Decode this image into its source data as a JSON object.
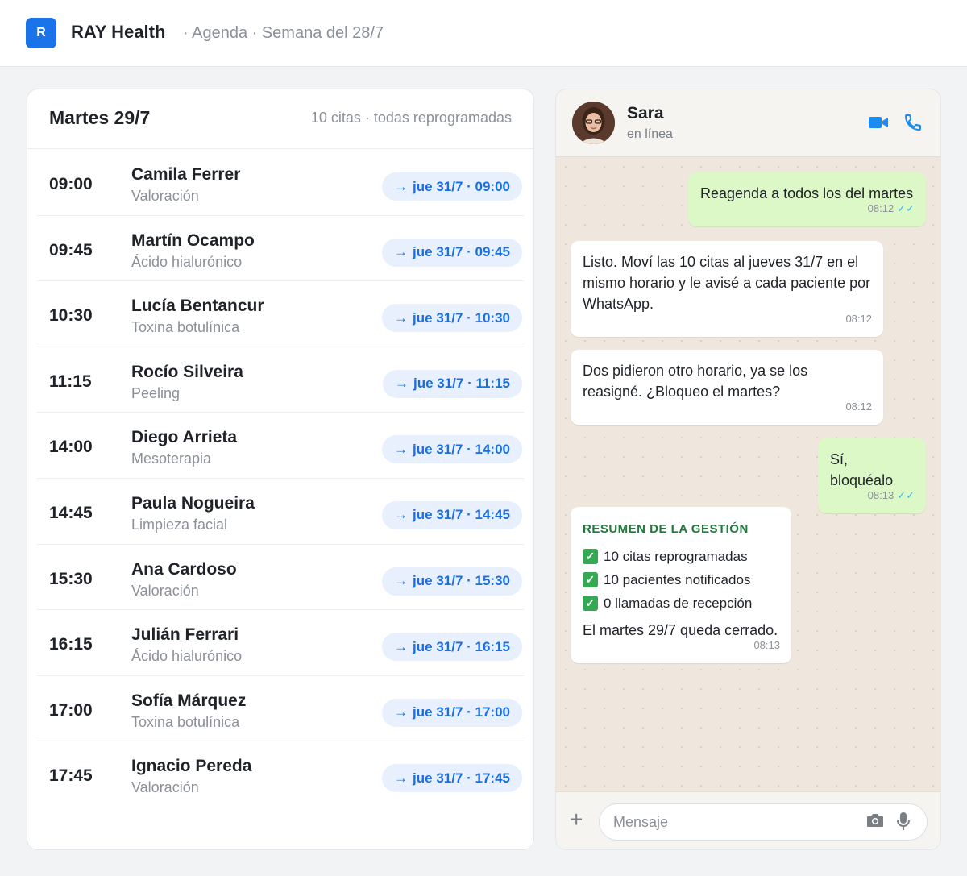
{
  "header": {
    "logo_letter": "R",
    "brand": "RAY Health",
    "breadcrumb": "· Agenda · Semana del 28/7"
  },
  "agenda": {
    "title": "Martes 29/7",
    "summary": "10 citas · todas reprogramadas",
    "arrow": "→",
    "rows": [
      {
        "time": "09:00",
        "name": "Camila Ferrer",
        "service": "Valoración",
        "new_slot": "jue 31/7 · 09:00"
      },
      {
        "time": "09:45",
        "name": "Martín Ocampo",
        "service": "Ácido hialurónico",
        "new_slot": "jue 31/7 · 09:45"
      },
      {
        "time": "10:30",
        "name": "Lucía Bentancur",
        "service": "Toxina botulínica",
        "new_slot": "jue 31/7 · 10:30"
      },
      {
        "time": "11:15",
        "name": "Rocío Silveira",
        "service": "Peeling",
        "new_slot": "jue 31/7 · 11:15"
      },
      {
        "time": "14:00",
        "name": "Diego Arrieta",
        "service": "Mesoterapia",
        "new_slot": "jue 31/7 · 14:00"
      },
      {
        "time": "14:45",
        "name": "Paula Nogueira",
        "service": "Limpieza facial",
        "new_slot": "jue 31/7 · 14:45"
      },
      {
        "time": "15:30",
        "name": "Ana Cardoso",
        "service": "Valoración",
        "new_slot": "jue 31/7 · 15:30"
      },
      {
        "time": "16:15",
        "name": "Julián Ferrari",
        "service": "Ácido hialurónico",
        "new_slot": "jue 31/7 · 16:15"
      },
      {
        "time": "17:00",
        "name": "Sofía Márquez",
        "service": "Toxina botulínica",
        "new_slot": "jue 31/7 · 17:00"
      },
      {
        "time": "17:45",
        "name": "Ignacio Pereda",
        "service": "Valoración",
        "new_slot": "jue 31/7 · 17:45"
      }
    ]
  },
  "chat": {
    "contact_name": "Sara",
    "presence": "en línea",
    "messages": [
      {
        "text": "Reagenda a todos los del martes",
        "time": "08:12",
        "ticks": "✓✓"
      },
      {
        "text": "Listo. Moví las 10 citas al jueves 31/7 en el mismo horario y le avisé a cada paciente por WhatsApp.",
        "time": "08:12"
      },
      {
        "text": "Dos pidieron otro horario, ya se los reasigné. ¿Bloqueo el martes?",
        "time": "08:12"
      },
      {
        "text": "Sí, bloquéalo",
        "time": "08:13",
        "ticks": "✓✓"
      }
    ],
    "summary": {
      "title": "RESUMEN DE LA GESTIÓN",
      "check_mark": "✓",
      "items": [
        "10 citas reprogramadas",
        "10 pacientes notificados",
        "0 llamadas de recepción"
      ],
      "footer": "El martes 29/7 queda cerrado.",
      "time": "08:13"
    },
    "composer_placeholder": "Mensaje",
    "composer_plus": "+"
  },
  "colors": {
    "brand_blue": "#1a73e8",
    "pill_bg": "#e8f0fd",
    "outgoing_bubble": "#dcf8c6",
    "chat_wallpaper": "#efe7dd",
    "summary_green": "#1e7a3c"
  }
}
